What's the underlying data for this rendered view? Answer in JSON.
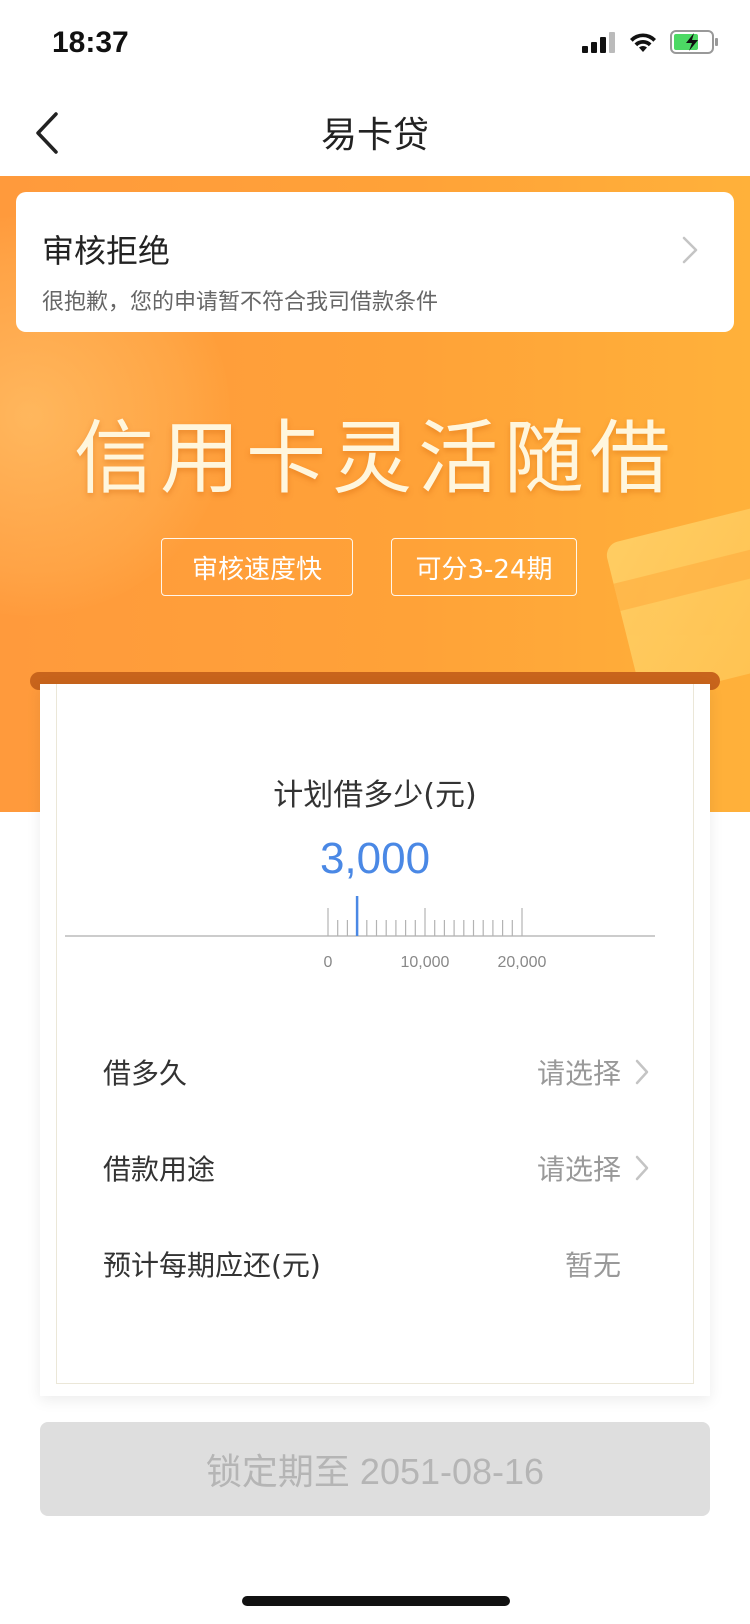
{
  "status_bar": {
    "time": "18:37",
    "icons": [
      "signal-icon",
      "wifi-icon",
      "battery-charging-icon"
    ]
  },
  "nav": {
    "title": "易卡贷",
    "back_icon": "chevron-left-icon"
  },
  "review_card": {
    "title": "审核拒绝",
    "message": "很抱歉，您的申请暂不符合我司借款条件"
  },
  "banner": {
    "slogan": "信用卡灵活随借",
    "tags": [
      "审核速度快",
      "可分3-24期"
    ]
  },
  "amount": {
    "label": "计划借多少(元)",
    "value": "3,000",
    "slider_value": 3000,
    "scale_min": 0,
    "scale_max": 20000,
    "tick_labels": [
      "0",
      "10,000",
      "20,000"
    ]
  },
  "form": {
    "rows": [
      {
        "label": "借多久",
        "value": "请选择"
      },
      {
        "label": "借款用途",
        "value": "请选择"
      },
      {
        "label": "预计每期应还(元)",
        "value": "暂无"
      }
    ]
  },
  "lock_button": {
    "label": "锁定期至 2051-08-16"
  },
  "colors": {
    "banner_orange": "#ffa238",
    "accent_blue": "#4a88e5",
    "disabled_gray": "#dedede"
  }
}
